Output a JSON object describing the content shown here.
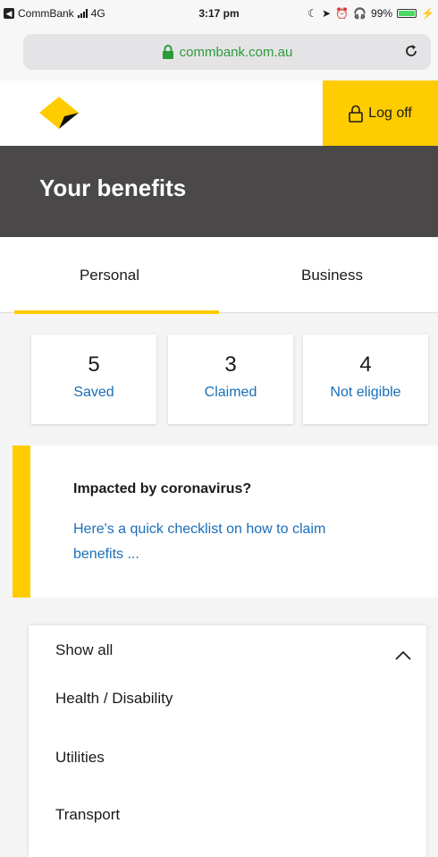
{
  "status": {
    "carrier": "CommBank",
    "network": "4G",
    "time": "3:17 pm",
    "battery": "99%",
    "battery_level": 0.99
  },
  "browser": {
    "url": "commbank.com.au"
  },
  "header": {
    "logoff_label": "Log off"
  },
  "page": {
    "title": "Your benefits"
  },
  "tabs": [
    {
      "label": "Personal",
      "active": true
    },
    {
      "label": "Business",
      "active": false
    }
  ],
  "stats": [
    {
      "count": "5",
      "label": "Saved"
    },
    {
      "count": "3",
      "label": "Claimed"
    },
    {
      "count": "4",
      "label": "Not eligible"
    }
  ],
  "notice": {
    "title": "Impacted by coronavirus?",
    "link": "Here's a quick checklist on how to claim benefits ..."
  },
  "filter": {
    "selected": "Show all",
    "options": [
      "Health / Disability",
      "Utilities",
      "Transport"
    ]
  },
  "colors": {
    "brand_yellow": "#ffcc00",
    "link_blue": "#1a6eb8",
    "title_bar": "#4a4848",
    "secure_green": "#2c9b3a"
  },
  "icons": {
    "lock": "lock-icon",
    "reload": "reload-icon",
    "chevron": "chevron-up-icon",
    "logo": "commbank-logo"
  }
}
